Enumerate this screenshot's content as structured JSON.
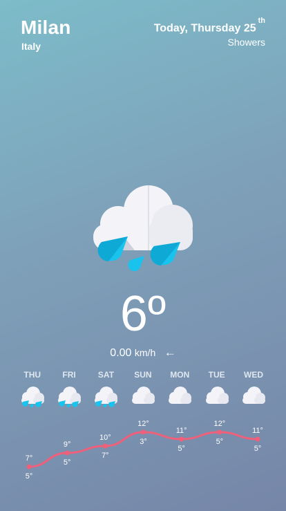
{
  "location": {
    "city": "Milan",
    "country": "Italy"
  },
  "date": {
    "prefix": "Today, Thursday 25",
    "suffix": "th"
  },
  "condition": "Showers",
  "current": {
    "icon": "cloud-rain-icon",
    "temperature": "6º",
    "wind_speed": "0.00",
    "wind_unit": "km/h",
    "wind_direction_icon": "arrow-left-icon"
  },
  "forecast": [
    {
      "day": "THU",
      "icon": "cloud-rain-icon",
      "high": "7°",
      "low": "5°"
    },
    {
      "day": "FRI",
      "icon": "cloud-rain-icon",
      "high": "9°",
      "low": "5°"
    },
    {
      "day": "SAT",
      "icon": "cloud-rain-icon",
      "high": "10°",
      "low": "7°"
    },
    {
      "day": "SUN",
      "icon": "cloud-icon",
      "high": "12°",
      "low": "3°"
    },
    {
      "day": "MON",
      "icon": "cloud-icon",
      "high": "11°",
      "low": "5°"
    },
    {
      "day": "TUE",
      "icon": "cloud-icon",
      "high": "12°",
      "low": "5°"
    },
    {
      "day": "WED",
      "icon": "cloud-icon",
      "high": "11°",
      "low": "5°"
    }
  ],
  "chart_data": {
    "type": "line",
    "categories": [
      "THU",
      "FRI",
      "SAT",
      "SUN",
      "MON",
      "TUE",
      "WED"
    ],
    "series": [
      {
        "values": [
          7,
          9,
          10,
          12,
          11,
          12,
          11
        ]
      }
    ],
    "low_labels": [
      5,
      5,
      7,
      3,
      5,
      5,
      5
    ],
    "line_color": "#f0607a"
  },
  "colors": {
    "drop": "#1ec8f0",
    "cloud": "#f4f4f8"
  }
}
